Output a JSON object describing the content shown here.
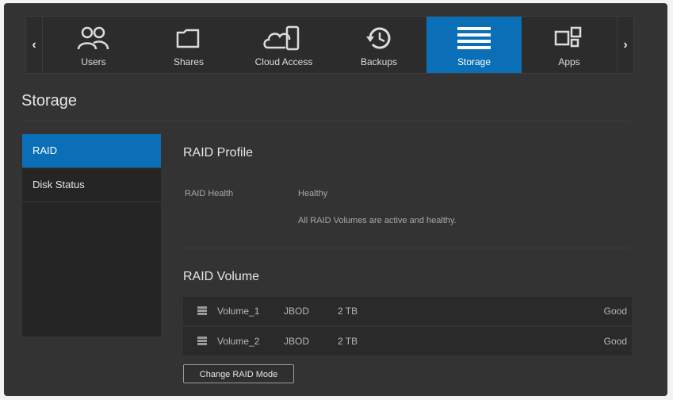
{
  "nav": {
    "items": [
      {
        "label": "Users",
        "icon": "users-icon"
      },
      {
        "label": "Shares",
        "icon": "cloud-folder-icon"
      },
      {
        "label": "Cloud Access",
        "icon": "cloud-device-icon"
      },
      {
        "label": "Backups",
        "icon": "history-icon"
      },
      {
        "label": "Storage",
        "icon": "storage-icon",
        "active": true
      },
      {
        "label": "Apps",
        "icon": "apps-icon"
      }
    ],
    "left_arrow": "‹",
    "right_arrow": "›",
    "accent": "#0a6fb6"
  },
  "page": {
    "title": "Storage"
  },
  "sidebar": {
    "items": [
      {
        "label": "RAID",
        "active": true
      },
      {
        "label": "Disk Status"
      }
    ]
  },
  "raid_profile": {
    "title": "RAID Profile",
    "health_label": "RAID Health",
    "health_value": "Healthy",
    "health_desc": "All RAID Volumes are active and healthy."
  },
  "raid_volume": {
    "title": "RAID Volume",
    "rows": [
      {
        "name": "Volume_1",
        "type": "JBOD",
        "size": "2 TB",
        "status": "Good"
      },
      {
        "name": "Volume_2",
        "type": "JBOD",
        "size": "2 TB",
        "status": "Good"
      }
    ],
    "button_label": "Change RAID Mode"
  }
}
